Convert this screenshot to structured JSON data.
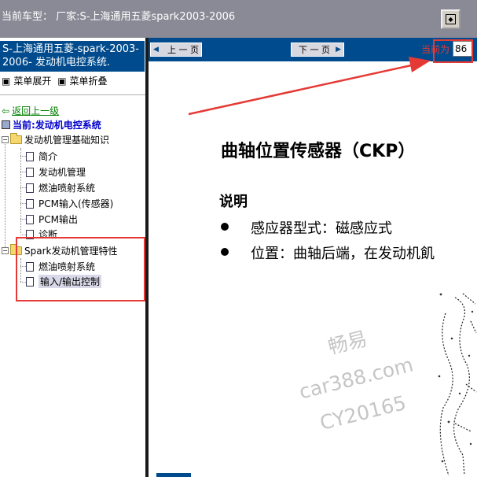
{
  "window": {
    "title": "当前车型：   厂家:S-上海通用五菱spark2003-2006"
  },
  "sidebar": {
    "header": "S-上海通用五菱-spark-2003-2006- 发动机电控系统.",
    "expand_label": "菜单展开",
    "collapse_label": "菜单折叠",
    "back_label": "返回上一级",
    "current_label": "当前:发动机电控系统",
    "tree": {
      "folder1": {
        "label": "发动机管理基础知识",
        "children": [
          "简介",
          "发动机管理",
          "燃油喷射系统",
          "PCM输入(传感器)",
          "PCM输出",
          "诊断"
        ]
      },
      "folder2": {
        "label": "Spark发动机管理特性",
        "children": [
          "燃油喷射系统",
          "输入/输出控制"
        ]
      }
    }
  },
  "toolbar": {
    "prev_label": "上 一 页",
    "next_label": "下 一 页",
    "page_label": "当前为",
    "page_value": "86"
  },
  "document": {
    "title": "曲轴位置传感器（CKP）",
    "section": "说明",
    "bullets": [
      "感应器型式：磁感应式",
      "位置：曲轴后端，在发动机飢"
    ]
  },
  "watermark": {
    "line1": "畅易",
    "line2": "car388.com",
    "line3": "CY20165"
  },
  "colors": {
    "header_blue": "#004b8d",
    "annotation_red": "#e53935",
    "link_green": "#008000",
    "current_blue": "#0000cc"
  }
}
